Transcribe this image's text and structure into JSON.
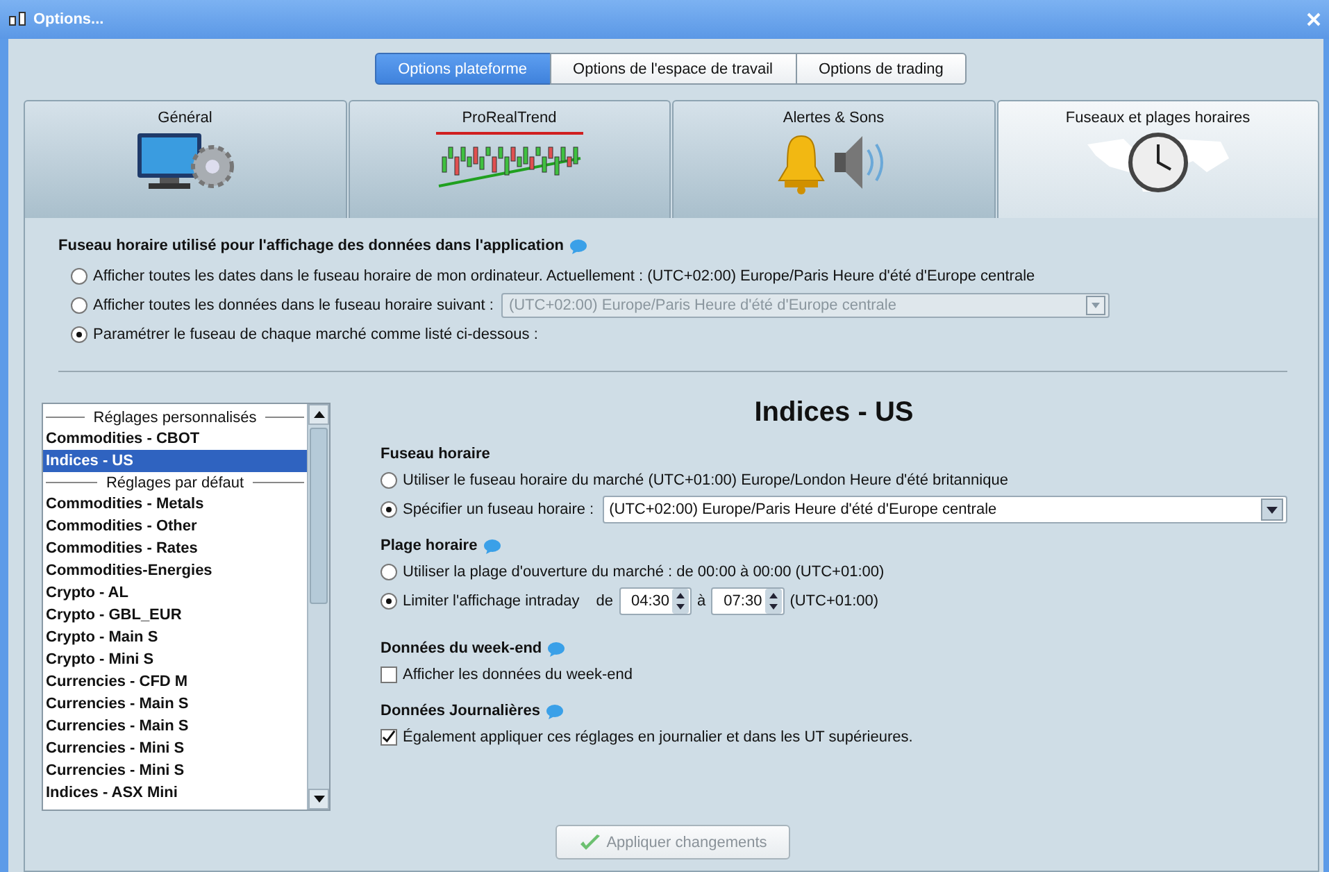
{
  "window": {
    "title": "Options..."
  },
  "top_tabs": [
    {
      "label": "Options plateforme",
      "selected": true
    },
    {
      "label": "Options de l'espace de travail",
      "selected": false
    },
    {
      "label": "Options de trading",
      "selected": false
    }
  ],
  "category_tabs": [
    {
      "label": "Général",
      "kind": "general",
      "selected": false
    },
    {
      "label": "ProRealTrend",
      "kind": "trend",
      "selected": false
    },
    {
      "label": "Alertes & Sons",
      "kind": "alerts",
      "selected": false
    },
    {
      "label": "Fuseaux et plages horaires",
      "kind": "timezones",
      "selected": true
    }
  ],
  "display_timezone": {
    "heading": "Fuseau horaire utilisé pour l'affichage des données dans l'application",
    "options": [
      {
        "label": "Afficher toutes les dates dans le fuseau horaire de mon ordinateur. Actuellement : (UTC+02:00) Europe/Paris Heure d'été d'Europe centrale",
        "selected": false
      },
      {
        "label": "Afficher toutes les données dans le fuseau horaire suivant :",
        "selected": false,
        "dropdown": {
          "value": "(UTC+02:00) Europe/Paris Heure d'été d'Europe centrale",
          "disabled": true
        }
      },
      {
        "label": "Paramétrer le fuseau de chaque marché comme listé ci-dessous :",
        "selected": true
      }
    ]
  },
  "market_list": [
    {
      "kind": "header",
      "label": "Réglages personnalisés"
    },
    {
      "kind": "item",
      "label": "Commodities - CBOT",
      "selected": false
    },
    {
      "kind": "item",
      "label": "Indices - US",
      "selected": true
    },
    {
      "kind": "header",
      "label": "Réglages par défaut"
    },
    {
      "kind": "item",
      "label": "Commodities - Metals",
      "selected": false
    },
    {
      "kind": "item",
      "label": "Commodities - Other",
      "selected": false
    },
    {
      "kind": "item",
      "label": "Commodities - Rates",
      "selected": false
    },
    {
      "kind": "item",
      "label": "Commodities-Energies",
      "selected": false
    },
    {
      "kind": "item",
      "label": "Crypto - AL",
      "selected": false
    },
    {
      "kind": "item",
      "label": "Crypto - GBL_EUR",
      "selected": false
    },
    {
      "kind": "item",
      "label": "Crypto - Main S",
      "selected": false
    },
    {
      "kind": "item",
      "label": "Crypto - Mini S",
      "selected": false
    },
    {
      "kind": "item",
      "label": "Currencies - CFD M",
      "selected": false
    },
    {
      "kind": "item",
      "label": "Currencies - Main S",
      "selected": false
    },
    {
      "kind": "item",
      "label": "Currencies - Main S",
      "selected": false
    },
    {
      "kind": "item",
      "label": "Currencies - Mini S",
      "selected": false
    },
    {
      "kind": "item",
      "label": "Currencies - Mini S",
      "selected": false
    },
    {
      "kind": "item",
      "label": "Indices - ASX Mini",
      "selected": false
    }
  ],
  "detail": {
    "title": "Indices - US",
    "timezone": {
      "heading": "Fuseau horaire",
      "options": [
        {
          "label": "Utiliser le fuseau horaire du marché (UTC+01:00) Europe/London Heure d'été britannique",
          "selected": false
        },
        {
          "label": "Spécifier un fuseau horaire :",
          "selected": true,
          "dropdown": {
            "value": "(UTC+02:00) Europe/Paris Heure d'été d'Europe centrale",
            "disabled": false
          }
        }
      ]
    },
    "hours": {
      "heading": "Plage horaire",
      "options": [
        {
          "label": "Utiliser la plage d'ouverture du marché : de 00:00 à 00:00  (UTC+01:00)",
          "selected": false
        },
        {
          "label": "Limiter l'affichage intraday",
          "selected": true,
          "range": {
            "from_label": "de",
            "from": "04:30",
            "to_label": "à",
            "to": "07:30",
            "zone": "(UTC+01:00)"
          }
        }
      ]
    },
    "weekend": {
      "heading": "Données du week-end",
      "checkbox": {
        "label": "Afficher les données du week-end",
        "checked": false
      }
    },
    "daily": {
      "heading": "Données Journalières",
      "checkbox": {
        "label": "Également appliquer ces réglages en journalier et dans les UT supérieures.",
        "checked": true
      }
    }
  },
  "apply_button": {
    "label": "Appliquer changements",
    "disabled": true
  }
}
